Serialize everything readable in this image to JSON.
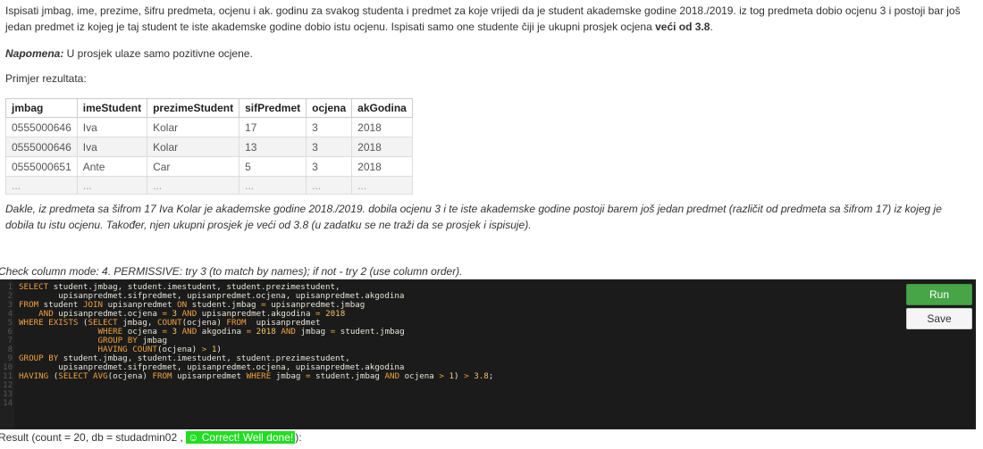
{
  "task": {
    "text": "Ispisati jmbag, ime, prezime, šifru predmeta, ocjenu i ak. godinu za svakog studenta i predmet za koje vrijedi da je student akademske godine 2018./2019. iz tog predmeta dobio ocjenu 3 i postoji bar još jedan predmet iz kojeg je taj student te iste akademske godine dobio istu ocjenu. Ispisati samo one studente čiji je ukupni prosjek ocjena ",
    "bold": "veći od 3.8",
    "end": "."
  },
  "note": {
    "label": "Napomena:",
    "text": " U prosjek ulaze samo pozitivne ocjene."
  },
  "example_label": "Primjer rezultata:",
  "table": {
    "headers": [
      "jmbag",
      "imeStudent",
      "prezimeStudent",
      "sifPredmet",
      "ocjena",
      "akGodina"
    ],
    "rows": [
      [
        "0555000646",
        "Iva",
        "Kolar",
        "17",
        "3",
        "2018"
      ],
      [
        "0555000646",
        "Iva",
        "Kolar",
        "13",
        "3",
        "2018"
      ],
      [
        "0555000651",
        "Ante",
        "Car",
        "5",
        "3",
        "2018"
      ],
      [
        "...",
        "...",
        "...",
        "...",
        "...",
        "..."
      ]
    ]
  },
  "explanation": "Dakle, iz predmeta sa šifrom 17 Iva Kolar je akademske godine 2018./2019. dobila ocjenu 3 i te iste akademske godine postoji barem još jedan predmet (različit od predmeta sa šifrom 17) iz kojeg je dobila tu istu ocjenu. Također, njen ukupni prosjek je veći od 3.8 (u zadatku se ne traži da se prosjek i ispisuje).",
  "check_mode": "Check column mode: 4. PERMISSIVE: try 3 (to match by names); if not - try 2 (use column order).",
  "editor": {
    "line_numbers": [
      "1",
      "2",
      "3",
      "4",
      "5",
      "6",
      "7",
      "8",
      "9",
      "10",
      "11",
      "12",
      "13",
      "14"
    ],
    "lines": [
      [
        {
          "t": "SELECT",
          "c": "kw"
        },
        {
          "t": " student.jmbag, student.imestudent, student.prezimestudent,",
          "c": "ident"
        }
      ],
      [
        {
          "t": "        upisanpredmet.sifpredmet, upisanpredmet.ocjena, upisanpredmet.akgodina",
          "c": "ident"
        }
      ],
      [
        {
          "t": "FROM",
          "c": "kw"
        },
        {
          "t": " student ",
          "c": "ident"
        },
        {
          "t": "JOIN",
          "c": "kw"
        },
        {
          "t": " upisanpredmet ",
          "c": "ident"
        },
        {
          "t": "ON",
          "c": "kw"
        },
        {
          "t": " student.jmbag ",
          "c": "ident"
        },
        {
          "t": "=",
          "c": "op"
        },
        {
          "t": " upisanpredmet.jmbag",
          "c": "ident"
        }
      ],
      [
        {
          "t": "    ",
          "c": "ident"
        },
        {
          "t": "AND",
          "c": "kw"
        },
        {
          "t": " upisanpredmet.ocjena ",
          "c": "ident"
        },
        {
          "t": "=",
          "c": "op"
        },
        {
          "t": " ",
          "c": "ident"
        },
        {
          "t": "3",
          "c": "num"
        },
        {
          "t": " ",
          "c": "ident"
        },
        {
          "t": "AND",
          "c": "kw"
        },
        {
          "t": " upisanpredmet.akgodina ",
          "c": "ident"
        },
        {
          "t": "=",
          "c": "op"
        },
        {
          "t": " ",
          "c": "ident"
        },
        {
          "t": "2018",
          "c": "num"
        }
      ],
      [
        {
          "t": "WHERE EXISTS",
          "c": "kw"
        },
        {
          "t": " (",
          "c": "ident"
        },
        {
          "t": "SELECT",
          "c": "kw"
        },
        {
          "t": " jmbag, ",
          "c": "ident"
        },
        {
          "t": "COUNT",
          "c": "kw"
        },
        {
          "t": "(ocjena) ",
          "c": "ident"
        },
        {
          "t": "FROM",
          "c": "kw"
        },
        {
          "t": "  upisanpredmet",
          "c": "ident"
        }
      ],
      [
        {
          "t": "                ",
          "c": "ident"
        },
        {
          "t": "WHERE",
          "c": "kw"
        },
        {
          "t": " ocjena ",
          "c": "ident"
        },
        {
          "t": "=",
          "c": "op"
        },
        {
          "t": " ",
          "c": "ident"
        },
        {
          "t": "3",
          "c": "num"
        },
        {
          "t": " ",
          "c": "ident"
        },
        {
          "t": "AND",
          "c": "kw"
        },
        {
          "t": " akgodina ",
          "c": "ident"
        },
        {
          "t": "=",
          "c": "op"
        },
        {
          "t": " ",
          "c": "ident"
        },
        {
          "t": "2018",
          "c": "num"
        },
        {
          "t": " ",
          "c": "ident"
        },
        {
          "t": "AND",
          "c": "kw"
        },
        {
          "t": " jmbag ",
          "c": "ident"
        },
        {
          "t": "=",
          "c": "op"
        },
        {
          "t": " student.jmbag",
          "c": "ident"
        }
      ],
      [
        {
          "t": "                ",
          "c": "ident"
        },
        {
          "t": "GROUP BY",
          "c": "kw"
        },
        {
          "t": " jmbag",
          "c": "ident"
        }
      ],
      [
        {
          "t": "                ",
          "c": "ident"
        },
        {
          "t": "HAVING",
          "c": "kw"
        },
        {
          "t": " ",
          "c": "ident"
        },
        {
          "t": "COUNT",
          "c": "kw"
        },
        {
          "t": "(ocjena) ",
          "c": "ident"
        },
        {
          "t": ">",
          "c": "op"
        },
        {
          "t": " ",
          "c": "ident"
        },
        {
          "t": "1",
          "c": "num"
        },
        {
          "t": ")",
          "c": "ident"
        }
      ],
      [
        {
          "t": "GROUP BY",
          "c": "kw"
        },
        {
          "t": " student.jmbag, student.imestudent, student.prezimestudent,",
          "c": "ident"
        }
      ],
      [
        {
          "t": "        upisanpredmet.sifpredmet, upisanpredmet.ocjena, upisanpredmet.akgodina",
          "c": "ident"
        }
      ],
      [
        {
          "t": "HAVING",
          "c": "kw"
        },
        {
          "t": " (",
          "c": "ident"
        },
        {
          "t": "SELECT",
          "c": "kw"
        },
        {
          "t": " ",
          "c": "ident"
        },
        {
          "t": "AVG",
          "c": "kw"
        },
        {
          "t": "(ocjena) ",
          "c": "ident"
        },
        {
          "t": "FROM",
          "c": "kw"
        },
        {
          "t": " upisanpredmet ",
          "c": "ident"
        },
        {
          "t": "WHERE",
          "c": "kw"
        },
        {
          "t": " jmbag ",
          "c": "ident"
        },
        {
          "t": "=",
          "c": "op"
        },
        {
          "t": " student.jmbag ",
          "c": "ident"
        },
        {
          "t": "AND",
          "c": "kw"
        },
        {
          "t": " ocjena ",
          "c": "ident"
        },
        {
          "t": ">",
          "c": "op"
        },
        {
          "t": " ",
          "c": "ident"
        },
        {
          "t": "1",
          "c": "num"
        },
        {
          "t": ") ",
          "c": "ident"
        },
        {
          "t": ">",
          "c": "op"
        },
        {
          "t": " ",
          "c": "ident"
        },
        {
          "t": "3.8",
          "c": "num"
        },
        {
          "t": ";",
          "c": "ident"
        }
      ],
      [],
      [],
      []
    ]
  },
  "buttons": {
    "run": "Run",
    "save": "Save"
  },
  "result": {
    "prefix": "Result (count = 20, db = studadmin02 ,",
    "badge": "☺ Correct! Well done!",
    "suffix": "):"
  },
  "colors": {
    "editor_bg": "#1a1b1a",
    "keyword": "#f0a040",
    "run_button": "#47a548",
    "success_badge": "#22dd22"
  }
}
